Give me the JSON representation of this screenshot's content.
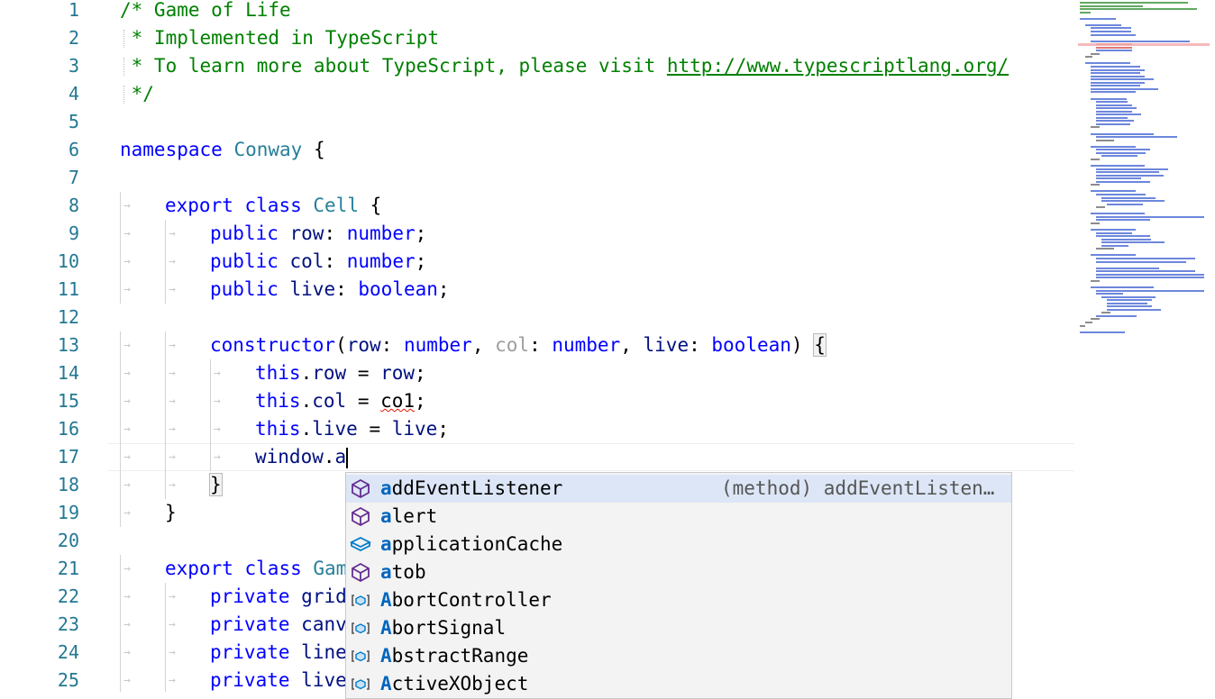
{
  "editor": {
    "lines": [
      {
        "n": "1",
        "indent": 0,
        "tokens": [
          {
            "t": "/* Game of Life",
            "c": "comment"
          }
        ]
      },
      {
        "n": "2",
        "indent": 0,
        "lead": true,
        "tokens": [
          {
            "t": " * Implemented in TypeScript",
            "c": "comment"
          }
        ]
      },
      {
        "n": "3",
        "indent": 0,
        "lead": true,
        "tokens": [
          {
            "t": " * To learn more about TypeScript, please visit ",
            "c": "comment"
          },
          {
            "t": "http://www.typescriptlang.org/",
            "c": "link"
          }
        ]
      },
      {
        "n": "4",
        "indent": 0,
        "lead": true,
        "tokens": [
          {
            "t": " */",
            "c": "comment"
          }
        ]
      },
      {
        "n": "5",
        "indent": 0,
        "tokens": []
      },
      {
        "n": "6",
        "indent": 0,
        "tokens": [
          {
            "t": "namespace",
            "c": "kw"
          },
          {
            "t": " "
          },
          {
            "t": "Conway",
            "c": "type"
          },
          {
            "t": " {"
          }
        ]
      },
      {
        "n": "7",
        "indent": 0,
        "tokens": []
      },
      {
        "n": "8",
        "indent": 1,
        "tokens": [
          {
            "t": "export",
            "c": "kw"
          },
          {
            "t": " "
          },
          {
            "t": "class",
            "c": "kw"
          },
          {
            "t": " "
          },
          {
            "t": "Cell",
            "c": "type"
          },
          {
            "t": " {"
          }
        ]
      },
      {
        "n": "9",
        "indent": 2,
        "tokens": [
          {
            "t": "public",
            "c": "kw"
          },
          {
            "t": " "
          },
          {
            "t": "row",
            "c": "ident"
          },
          {
            "t": ": "
          },
          {
            "t": "number",
            "c": "kw"
          },
          {
            "t": ";"
          }
        ]
      },
      {
        "n": "10",
        "indent": 2,
        "tokens": [
          {
            "t": "public",
            "c": "kw"
          },
          {
            "t": " "
          },
          {
            "t": "col",
            "c": "ident"
          },
          {
            "t": ": "
          },
          {
            "t": "number",
            "c": "kw"
          },
          {
            "t": ";"
          }
        ]
      },
      {
        "n": "11",
        "indent": 2,
        "tokens": [
          {
            "t": "public",
            "c": "kw"
          },
          {
            "t": " "
          },
          {
            "t": "live",
            "c": "ident"
          },
          {
            "t": ": "
          },
          {
            "t": "boolean",
            "c": "kw"
          },
          {
            "t": ";"
          }
        ]
      },
      {
        "n": "12",
        "indent": 0,
        "tokens": []
      },
      {
        "n": "13",
        "indent": 2,
        "tokens": [
          {
            "t": "constructor",
            "c": "kw"
          },
          {
            "t": "("
          },
          {
            "t": "row",
            "c": "ident"
          },
          {
            "t": ": "
          },
          {
            "t": "number",
            "c": "kw"
          },
          {
            "t": ", "
          },
          {
            "t": "col",
            "c": "faded"
          },
          {
            "t": ": "
          },
          {
            "t": "number",
            "c": "kw"
          },
          {
            "t": ", "
          },
          {
            "t": "live",
            "c": "ident"
          },
          {
            "t": ": "
          },
          {
            "t": "boolean",
            "c": "kw"
          },
          {
            "t": ") "
          },
          {
            "t": "{",
            "c": "bracket"
          }
        ]
      },
      {
        "n": "14",
        "indent": 3,
        "tokens": [
          {
            "t": "this",
            "c": "kw"
          },
          {
            "t": "."
          },
          {
            "t": "row",
            "c": "ident"
          },
          {
            "t": " = "
          },
          {
            "t": "row",
            "c": "ident"
          },
          {
            "t": ";"
          }
        ]
      },
      {
        "n": "15",
        "indent": 3,
        "tokens": [
          {
            "t": "this",
            "c": "kw"
          },
          {
            "t": "."
          },
          {
            "t": "col",
            "c": "ident"
          },
          {
            "t": " = "
          },
          {
            "t": "co1",
            "c": "err"
          },
          {
            "t": ";"
          }
        ]
      },
      {
        "n": "16",
        "indent": 3,
        "tokens": [
          {
            "t": "this",
            "c": "kw"
          },
          {
            "t": "."
          },
          {
            "t": "live",
            "c": "ident"
          },
          {
            "t": " = "
          },
          {
            "t": "live",
            "c": "ident"
          },
          {
            "t": ";"
          }
        ]
      },
      {
        "n": "17",
        "indent": 3,
        "current": true,
        "tokens": [
          {
            "t": "window",
            "c": "ident"
          },
          {
            "t": "."
          },
          {
            "t": "a",
            "c": "ident"
          }
        ]
      },
      {
        "n": "18",
        "indent": 2,
        "tokens": [
          {
            "t": "}",
            "c": "bracket"
          }
        ]
      },
      {
        "n": "19",
        "indent": 1,
        "tokens": [
          {
            "t": "}"
          }
        ]
      },
      {
        "n": "20",
        "indent": 0,
        "tokens": []
      },
      {
        "n": "21",
        "indent": 1,
        "tokens": [
          {
            "t": "export",
            "c": "kw"
          },
          {
            "t": " "
          },
          {
            "t": "class",
            "c": "kw"
          },
          {
            "t": " "
          },
          {
            "t": "Gam",
            "c": "type"
          }
        ]
      },
      {
        "n": "22",
        "indent": 2,
        "tokens": [
          {
            "t": "private",
            "c": "kw"
          },
          {
            "t": " "
          },
          {
            "t": "grid",
            "c": "ident"
          }
        ]
      },
      {
        "n": "23",
        "indent": 2,
        "tokens": [
          {
            "t": "private",
            "c": "kw"
          },
          {
            "t": " "
          },
          {
            "t": "canv",
            "c": "ident"
          }
        ]
      },
      {
        "n": "24",
        "indent": 2,
        "tokens": [
          {
            "t": "private",
            "c": "kw"
          },
          {
            "t": " "
          },
          {
            "t": "line",
            "c": "ident"
          }
        ]
      },
      {
        "n": "25",
        "indent": 2,
        "tokens": [
          {
            "t": "private",
            "c": "kw"
          },
          {
            "t": " "
          },
          {
            "t": "live",
            "c": "ident"
          }
        ]
      }
    ]
  },
  "suggest": {
    "items": [
      {
        "match": "a",
        "rest": "ddEventListener",
        "kind": "method",
        "detail": "(method) addEventListen…",
        "selected": true
      },
      {
        "match": "a",
        "rest": "lert",
        "kind": "method"
      },
      {
        "match": "a",
        "rest": "pplicationCache",
        "kind": "property"
      },
      {
        "match": "a",
        "rest": "tob",
        "kind": "method"
      },
      {
        "match": "A",
        "rest": "bortController",
        "kind": "variable"
      },
      {
        "match": "A",
        "rest": "bortSignal",
        "kind": "variable"
      },
      {
        "match": "A",
        "rest": "bstractRange",
        "kind": "variable"
      },
      {
        "match": "A",
        "rest": "ctiveXObject",
        "kind": "variable"
      }
    ]
  },
  "colors": {
    "method_icon": "#652d90",
    "property_icon": "#007acc",
    "variable_icon": "#007acc",
    "match_highlight": "#0066bf",
    "selected_row": "#dce6f6"
  }
}
